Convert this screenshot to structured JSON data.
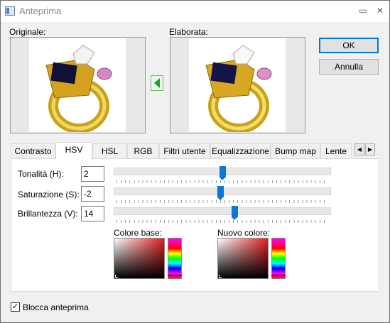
{
  "window": {
    "title": "Anteprima"
  },
  "titlebar": {
    "maximize_glyph": "▭",
    "close_glyph": "✕"
  },
  "preview": {
    "original_label": "Originale:",
    "processed_label": "Elaborata:"
  },
  "buttons": {
    "ok": "OK",
    "cancel": "Annulla",
    "copy_icon": "arrow-left-icon"
  },
  "tabs": {
    "items": [
      "Contrasto",
      "HSV",
      "HSL",
      "RGB",
      "Filtri utente",
      "Equalizzazione",
      "Bump map",
      "Lente"
    ],
    "selected": "HSV",
    "scroll_left": "◀",
    "scroll_right": "▶"
  },
  "hsv": {
    "hue": {
      "label": "Tonalità (H):",
      "value": "2",
      "slider_fraction": 0.5
    },
    "saturation": {
      "label": "Saturazione (S):",
      "value": "-2",
      "slider_fraction": 0.49
    },
    "brightness": {
      "label": "Brillantezza (V):",
      "value": "14",
      "slider_fraction": 0.56
    }
  },
  "colors": {
    "base_label": "Colore base:",
    "new_label": "Nuovo colore:",
    "base_hue_color": "#e02020",
    "new_hue_color": "#e02020",
    "accent": "#0078d7"
  },
  "footer": {
    "lock_preview_label": "Blocca anteprima",
    "lock_preview_checked": "✓"
  }
}
